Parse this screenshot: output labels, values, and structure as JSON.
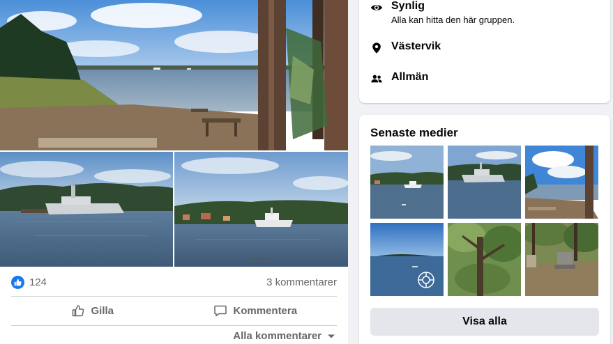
{
  "post": {
    "reaction_count": "124",
    "comment_count": "3 kommentarer",
    "like_label": "Gilla",
    "comment_label": "Kommentera",
    "all_comments_label": "Alla kommentarer"
  },
  "about": {
    "items": [
      {
        "title": "Synlig",
        "subtitle": "Alla kan hitta den här gruppen.",
        "icon": "eye-icon"
      },
      {
        "title": "Västervik",
        "icon": "location-pin-icon"
      },
      {
        "title": "Allmän",
        "icon": "people-icon"
      }
    ]
  },
  "media": {
    "heading": "Senaste medier",
    "show_all_label": "Visa alla"
  },
  "colors": {
    "accent": "#1877f2",
    "secondary_text": "#65676b",
    "button_bg": "#e4e6eb",
    "page_bg": "#f0f2f5"
  }
}
